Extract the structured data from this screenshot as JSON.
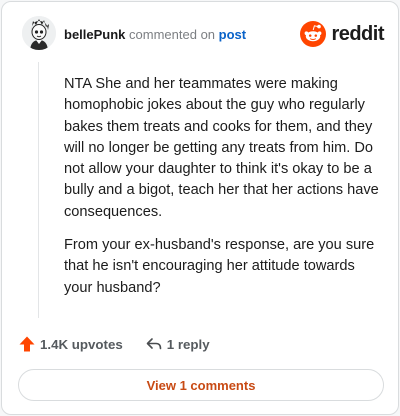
{
  "header": {
    "username": "bellePunk",
    "commented_text": "commented on",
    "post_link": "post",
    "brand": "reddit"
  },
  "comment": {
    "paragraphs": [
      "NTA She and her teammates were making homophobic jokes about the guy who regularly bakes them treats and cooks for them, and they will no longer be getting any treats from him. Do not allow your daughter to think it's okay to be a bully and a bigot, teach her that her actions have consequences.",
      "From your ex-husband's response, are you sure that he isn't encouraging her attitude towards your husband?"
    ]
  },
  "actions": {
    "upvotes": "1.4K upvotes",
    "replies": "1 reply"
  },
  "footer": {
    "view_comments": "View 1 comments"
  },
  "colors": {
    "brand_orange": "#ff4500",
    "link_blue": "#0a63c9",
    "view_button_text": "#c84a14"
  }
}
